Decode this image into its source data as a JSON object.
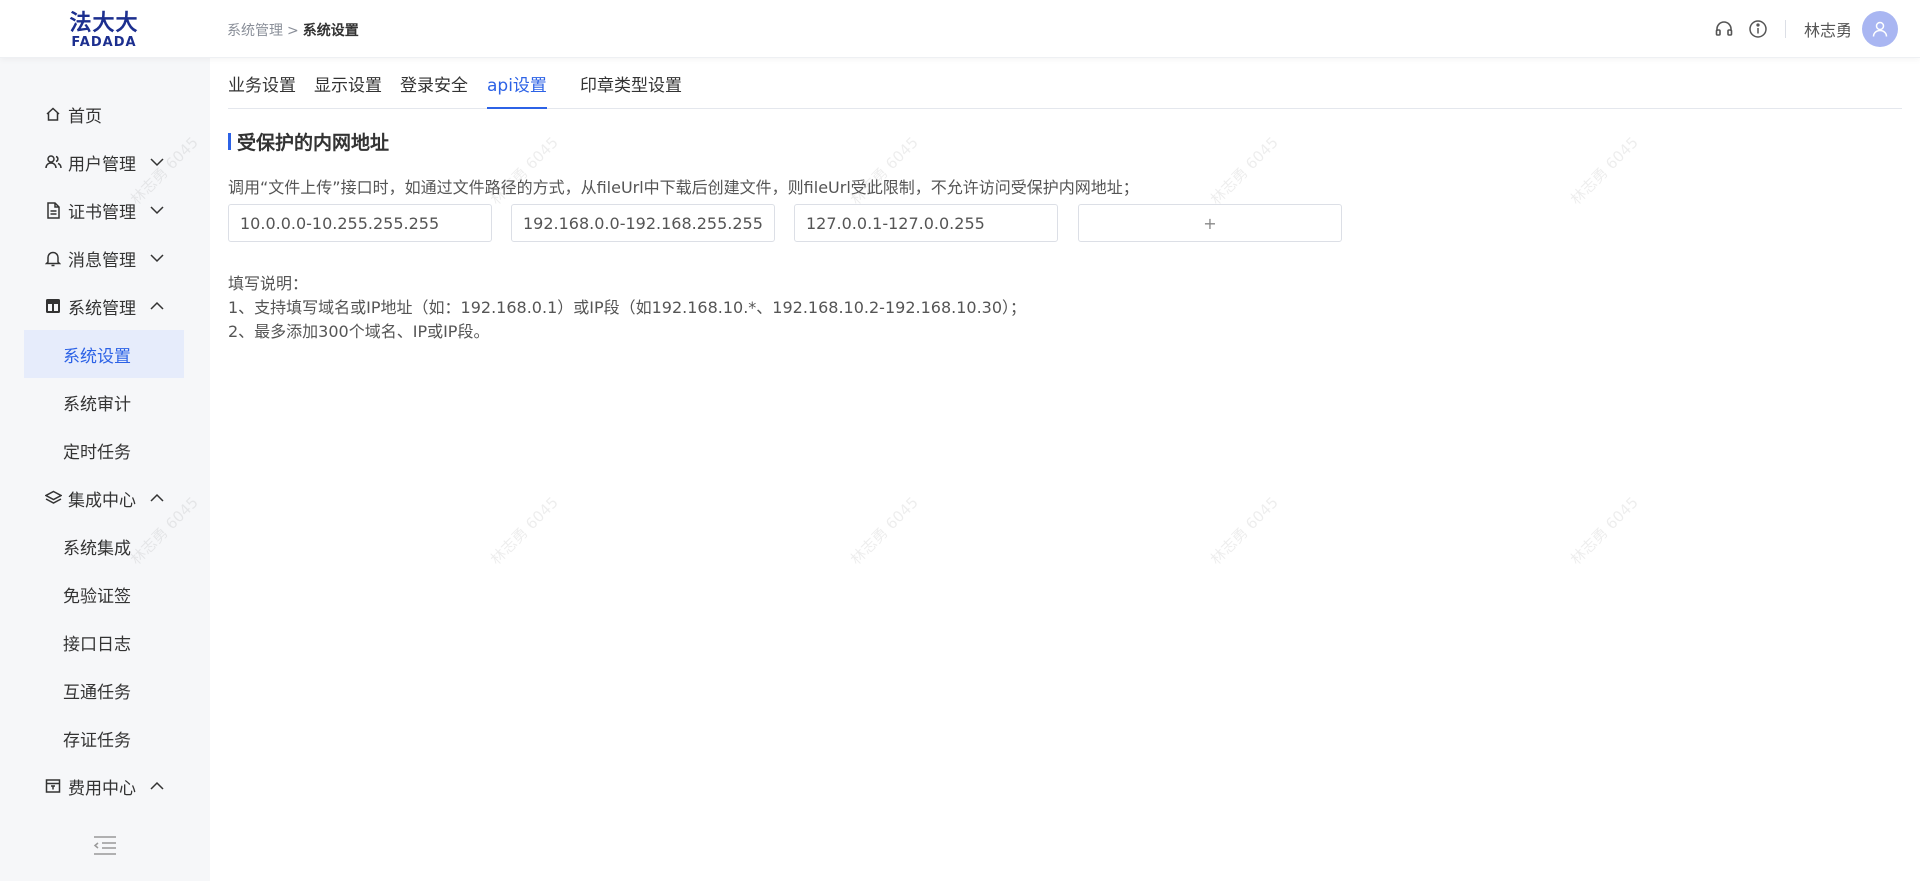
{
  "header": {
    "logo_cn": "法大大",
    "logo_en": "FADADA",
    "breadcrumb": {
      "parent": "系统管理",
      "separator": ">",
      "current": "系统设置"
    },
    "icons": [
      "headset-icon",
      "info-icon"
    ],
    "username": "林志勇"
  },
  "sidebar": {
    "items": [
      {
        "label": "首页",
        "icon": "home-icon"
      },
      {
        "label": "用户管理",
        "icon": "users-icon",
        "chevron": "down"
      },
      {
        "label": "证书管理",
        "icon": "document-icon",
        "chevron": "down"
      },
      {
        "label": "消息管理",
        "icon": "bell-icon",
        "chevron": "down"
      },
      {
        "label": "系统管理",
        "icon": "system-icon",
        "chevron": "up"
      },
      {
        "label": "集成中心",
        "icon": "layers-icon",
        "chevron": "up"
      },
      {
        "label": "费用中心",
        "icon": "wallet-icon",
        "chevron": "up"
      }
    ],
    "sub_items": {
      "system": [
        "系统设置",
        "系统审计",
        "定时任务"
      ],
      "integration": [
        "系统集成",
        "免验证签",
        "接口日志",
        "互通任务",
        "存证任务"
      ]
    },
    "active_sub": "系统设置"
  },
  "main": {
    "tabs": [
      "业务设置",
      "显示设置",
      "登录安全",
      "api设置",
      "印章类型设置"
    ],
    "active_tab": "api设置",
    "section_title": "受保护的内网地址",
    "description": "调用“文件上传”接口时，如通过文件路径的方式，从fileUrl中下载后创建文件，则fileUrl受此限制，不允许访问受保护内网地址；",
    "ip_ranges": [
      "10.0.0.0-10.255.255.255",
      "192.168.0.0-192.168.255.255",
      "127.0.0.1-127.0.0.255"
    ],
    "add_button": "+",
    "notes": {
      "title": "填写说明：",
      "line1": "1、支持填写域名或IP地址（如：192.168.0.1）或IP段（如192.168.10.*、192.168.10.2-192.168.10.30）；",
      "line2": "2、最多添加300个域名、IP或IP段。"
    }
  },
  "watermark": "林志勇 6045",
  "colors": {
    "brand": "#1c2f8f",
    "accent": "#2c62e6",
    "active_bg": "#e6ecfb",
    "sidebar_bg": "#f6f7f9",
    "avatar": "#a9b6f2"
  }
}
